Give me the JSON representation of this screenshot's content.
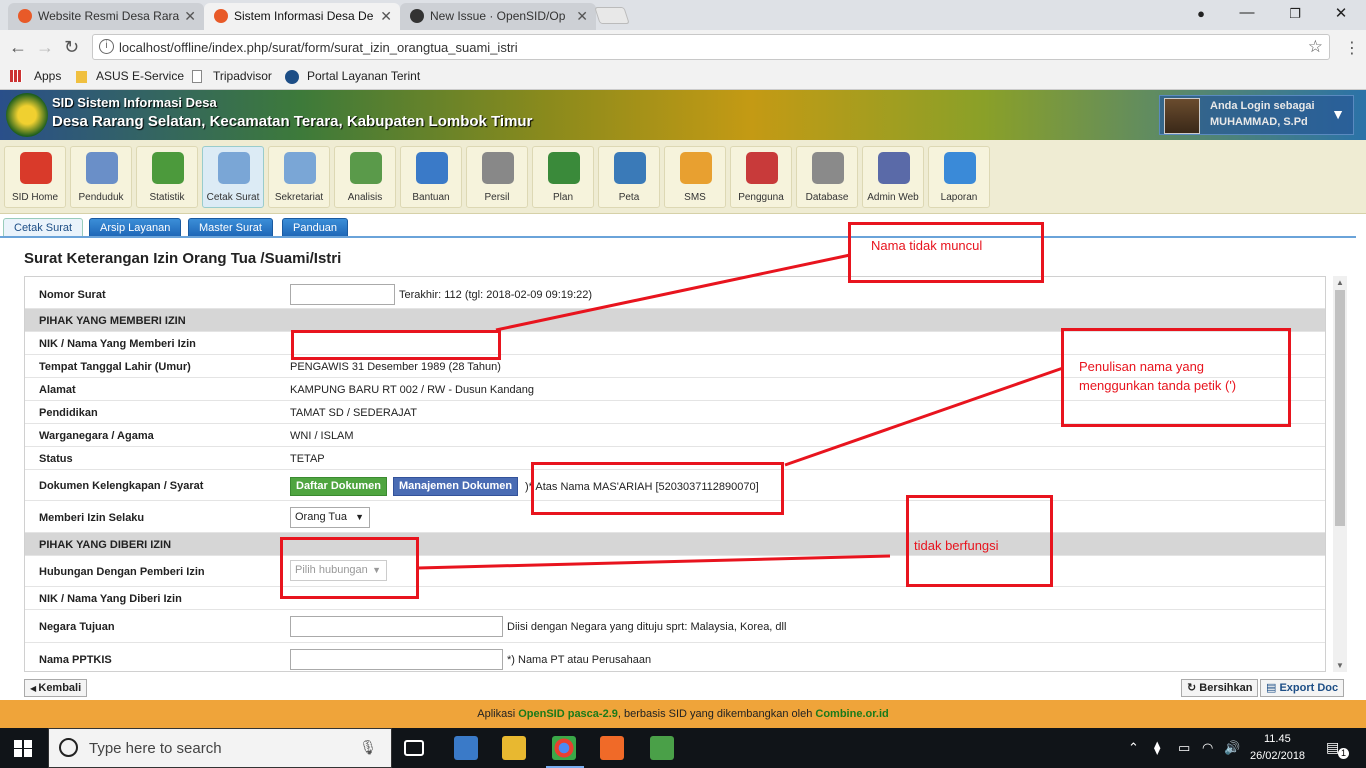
{
  "browser": {
    "tabs": [
      {
        "title": "Website Resmi Desa Rara"
      },
      {
        "title": "Sistem Informasi Desa De"
      },
      {
        "title": "New Issue · OpenSID/Op"
      }
    ],
    "url": "localhost/offline/index.php/surat/form/surat_izin_orangtua_suami_istri",
    "bookmarks": [
      "Apps",
      "ASUS E-Service",
      "Tripadvisor",
      "Portal Layanan Terint"
    ]
  },
  "header": {
    "app_name": "SID Sistem Informasi Desa",
    "village": "Desa Rarang Selatan, Kecamatan Terara, Kabupaten Lombok Timur",
    "login_label": "Anda Login sebagai",
    "user_name": "MUHAMMAD, S.Pd"
  },
  "toolbar": [
    {
      "label": "SID Home",
      "color": "#d93a2a"
    },
    {
      "label": "Penduduk",
      "color": "#6a8fc8"
    },
    {
      "label": "Statistik",
      "color": "#4c9a3c"
    },
    {
      "label": "Cetak Surat",
      "color": "#7aa6d6"
    },
    {
      "label": "Sekretariat",
      "color": "#7aa6d6"
    },
    {
      "label": "Analisis",
      "color": "#5a9a4a"
    },
    {
      "label": "Bantuan",
      "color": "#3a7ac8"
    },
    {
      "label": "Persil",
      "color": "#888888"
    },
    {
      "label": "Plan",
      "color": "#3a8a3a"
    },
    {
      "label": "Peta",
      "color": "#3a7ab8"
    },
    {
      "label": "SMS",
      "color": "#e8a030"
    },
    {
      "label": "Pengguna",
      "color": "#c83a3a"
    },
    {
      "label": "Database",
      "color": "#8a8a8a"
    },
    {
      "label": "Admin Web",
      "color": "#5a6aa8"
    },
    {
      "label": "Laporan",
      "color": "#3a8ad8"
    }
  ],
  "subtabs": [
    "Cetak Surat",
    "Arsip Layanan",
    "Master Surat",
    "Panduan"
  ],
  "page_title": "Surat Keterangan Izin Orang Tua /Suami/Istri",
  "form": {
    "nomor_surat_label": "Nomor Surat",
    "nomor_surat_hint": "Terakhir: 112 (tgl: 2018-02-09 09:19:22)",
    "section1": "PIHAK YANG MEMBERI IZIN",
    "nik_label": "NIK / Nama Yang Memberi Izin",
    "ttl_label": "Tempat Tanggal Lahir (Umur)",
    "ttl_value": "PENGAWIS 31 Desember 1989 (28 Tahun)",
    "alamat_label": "Alamat",
    "alamat_value": "KAMPUNG BARU RT 002 / RW - Dusun Kandang",
    "pendidikan_label": "Pendidikan",
    "pendidikan_value": "TAMAT SD / SEDERAJAT",
    "warga_label": "Warganegara / Agama",
    "warga_value": "WNI / ISLAM",
    "status_label": "Status",
    "status_value": "TETAP",
    "dokumen_label": "Dokumen Kelengkapan / Syarat",
    "btn_daftar": "Daftar Dokumen",
    "btn_manajemen": "Manajemen Dokumen",
    "dokumen_note": ")* Atas Nama MAS'ARIAH [5203037112890070]",
    "selaku_label": "Memberi Izin Selaku",
    "selaku_value": "Orang Tua",
    "section2": "PIHAK YANG DIBERI IZIN",
    "hubungan_label": "Hubungan Dengan Pemberi Izin",
    "hubungan_placeholder": "Pilih hubungan",
    "nik2_label": "NIK / Nama Yang Diberi Izin",
    "negara_label": "Negara Tujuan",
    "negara_hint": "Diisi dengan Negara yang dituju sprt: Malaysia, Korea, dll",
    "pptkis_label": "Nama PPTKIS",
    "pptkis_hint": "*) Nama PT atau Perusahaan"
  },
  "buttons": {
    "kembali": "Kembali",
    "bersihkan": "Bersihkan",
    "export": "Export Doc"
  },
  "footer": {
    "prefix": "Aplikasi",
    "app": "OpenSID pasca-2.9",
    "middle": ", berbasis SID yang dikembangkan oleh",
    "link": "Combine.or.id"
  },
  "annotations": {
    "a1": "Nama tidak muncul",
    "a2": "Penulisan nama yang menggunkan tanda petik (')",
    "a3": "tidak berfungsi"
  },
  "taskbar": {
    "search_placeholder": "Type here to search",
    "time": "11.45",
    "date": "26/02/2018",
    "notif_count": "1"
  }
}
